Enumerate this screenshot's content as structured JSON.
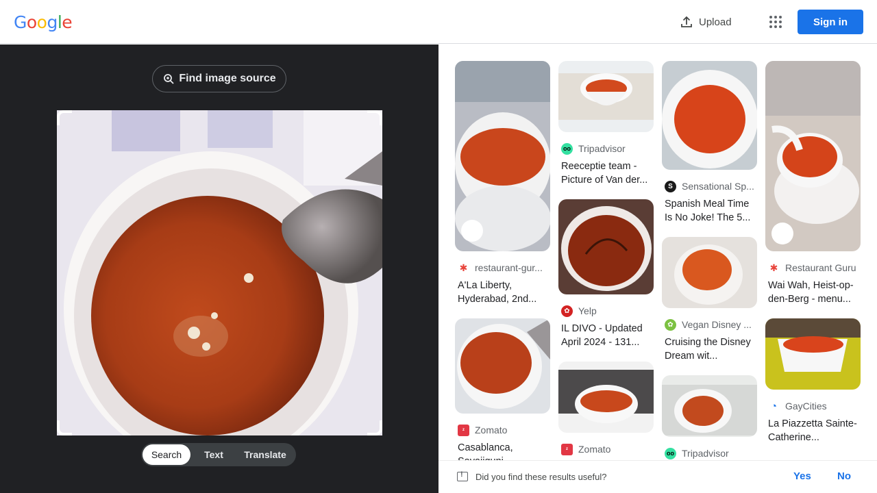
{
  "header": {
    "logo_letters": [
      "G",
      "o",
      "o",
      "g",
      "l",
      "e"
    ],
    "logo_colors": [
      "#4285f4",
      "#ea4335",
      "#fbbc05",
      "#4285f4",
      "#34a853",
      "#ea4335"
    ],
    "upload_label": "Upload",
    "signin_label": "Sign in"
  },
  "lens": {
    "find_source_label": "Find image source",
    "tabs": [
      "Search",
      "Text",
      "Translate"
    ],
    "active_tab": "Search"
  },
  "results": [
    {
      "source": "restaurant-gur...",
      "title": "A'La Liberty, Hyderabad, 2nd...",
      "icon": "restaurant-guru-icon",
      "color": "#e8453c"
    },
    {
      "source": "Zomato",
      "title": "Casablanca, Sayajiguni...",
      "icon": "zomato-icon",
      "color": "#e23744"
    },
    {
      "source": "Tripadvisor",
      "title": "Reeceptie team - Picture of Van der...",
      "icon": "tripadvisor-icon",
      "color": "#34e0a1"
    },
    {
      "source": "Yelp",
      "title": "IL DIVO - Updated April 2024 - 131...",
      "icon": "yelp-icon",
      "color": "#d32323"
    },
    {
      "source": "Zomato",
      "title": "",
      "icon": "zomato-icon",
      "color": "#e23744"
    },
    {
      "source": "Sensational Sp...",
      "title": "Spanish Meal Time Is No Joke! The 5...",
      "icon": "sensational-spain-icon",
      "color": "#1a1a1a"
    },
    {
      "source": "Vegan Disney ...",
      "title": "Cruising the Disney Dream wit...",
      "icon": "vegan-disney-icon",
      "color": "#7cc142"
    },
    {
      "source": "Tripadvisor",
      "title": "",
      "icon": "tripadvisor-icon",
      "color": "#34e0a1"
    },
    {
      "source": "Restaurant Guru",
      "title": "Wai Wah, Heist-op-den-Berg - menu...",
      "icon": "restaurant-guru-icon",
      "color": "#e8453c"
    },
    {
      "source": "GayCities",
      "title": "La Piazzetta Sainte-Catherine...",
      "icon": "gaycities-icon",
      "color": "#1a73e8"
    }
  ],
  "feedback": {
    "question": "Did you find these results useful?",
    "yes": "Yes",
    "no": "No"
  }
}
